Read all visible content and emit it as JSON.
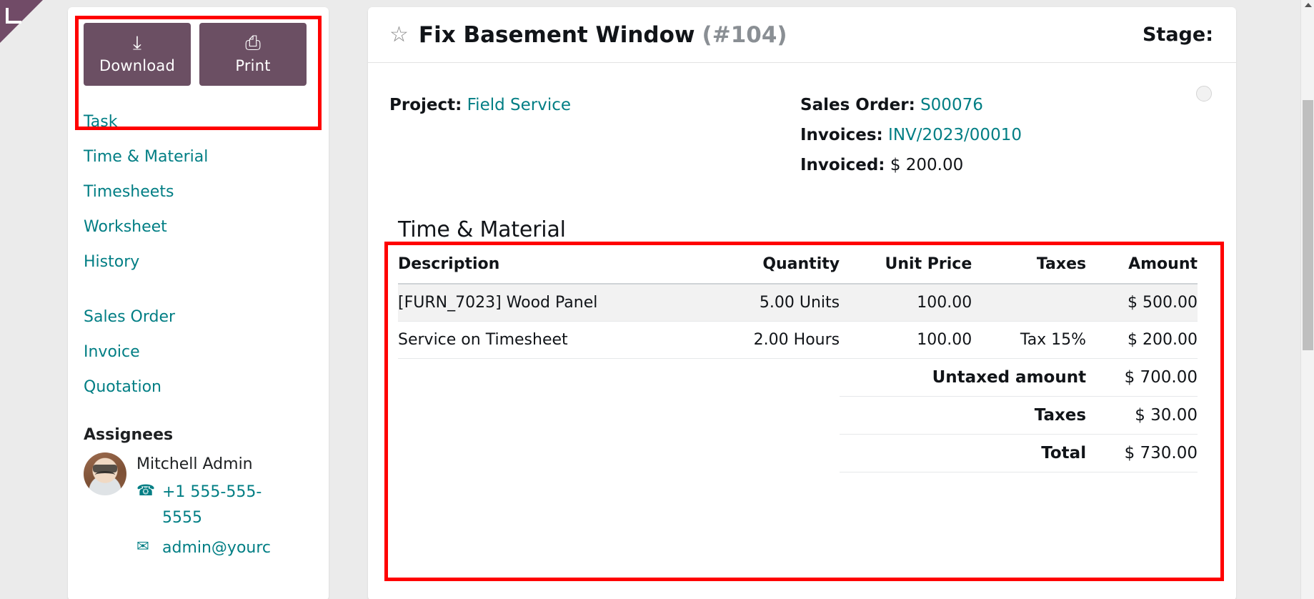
{
  "corner": {
    "icon": "back-arrow-corner-icon"
  },
  "sidebar": {
    "buttons": [
      {
        "label": "Download",
        "icon": "download-icon",
        "glyph": "⤓"
      },
      {
        "label": "Print",
        "icon": "print-icon",
        "glyph": "⎙"
      }
    ],
    "nav_group_1": [
      "Task",
      "Time & Material",
      "Timesheets",
      "Worksheet",
      "History"
    ],
    "nav_group_2": [
      "Sales Order",
      "Invoice",
      "Quotation"
    ],
    "assignees_title": "Assignees",
    "assignee": {
      "name": "Mitchell Admin",
      "phone": "+1 555-555-5555",
      "email": "admin@yourc",
      "phone_icon": "phone-icon",
      "email_icon": "envelope-icon"
    }
  },
  "main": {
    "star_icon": "star-outline-icon",
    "title": "Fix Basement Window",
    "task_number": "(#104)",
    "stage_label": "Stage:",
    "info": {
      "project_label": "Project:",
      "project_value": "Field Service",
      "sales_order_label": "Sales Order:",
      "sales_order_value": "S00076",
      "invoices_label": "Invoices:",
      "invoices_value": "INV/2023/00010",
      "invoiced_label": "Invoiced:",
      "invoiced_value": "$ 200.00"
    },
    "time_material": {
      "title": "Time & Material",
      "columns": {
        "description": "Description",
        "quantity": "Quantity",
        "unit_price": "Unit Price",
        "taxes": "Taxes",
        "amount": "Amount"
      },
      "rows": [
        {
          "description": "[FURN_7023] Wood Panel",
          "quantity": "5.00 Units",
          "unit_price": "100.00",
          "taxes": "",
          "amount": "$ 500.00"
        },
        {
          "description": "Service on Timesheet",
          "quantity": "2.00 Hours",
          "unit_price": "100.00",
          "taxes": "Tax 15%",
          "amount": "$ 200.00"
        }
      ],
      "totals": [
        {
          "label": "Untaxed amount",
          "value": "$ 700.00"
        },
        {
          "label": "Taxes",
          "value": "$ 30.00"
        },
        {
          "label": "Total",
          "value": "$ 730.00"
        }
      ]
    }
  },
  "colors": {
    "brand_purple": "#714B67",
    "button_purple": "#6b4f63",
    "link_teal": "#017e84",
    "annotation_red": "#ff0000",
    "page_bg": "#ebebeb"
  }
}
